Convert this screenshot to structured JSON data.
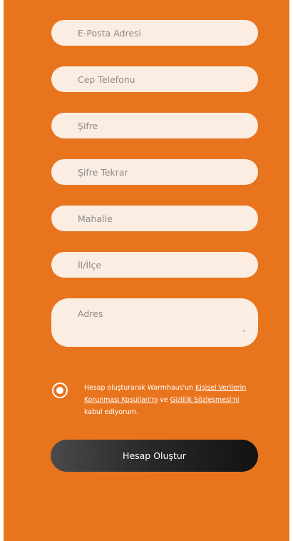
{
  "form": {
    "email_placeholder": "E-Posta Adresi",
    "phone_placeholder": "Cep Telefonu",
    "password_placeholder": "Şifre",
    "password_repeat_placeholder": "Şifre Tekrar",
    "neighborhood_placeholder": "Mahalle",
    "district_placeholder": "İl/İlçe",
    "address_placeholder": "Adres"
  },
  "consent": {
    "selected": true,
    "text_before": "Hesap oluşturarak Warmhaus'un ",
    "link_kvkk": "Kişisel Verilerin Korunması Koşulları'nı",
    "text_and": " ve ",
    "link_privacy": "Gizlilik Sözleşmesi'ni",
    "text_after": " kabul ediyorum."
  },
  "submit": {
    "label": "Hesap Oluştur"
  },
  "colors": {
    "background": "#E8751E",
    "field": "#FCEDE2",
    "button_dark": "#121212"
  }
}
